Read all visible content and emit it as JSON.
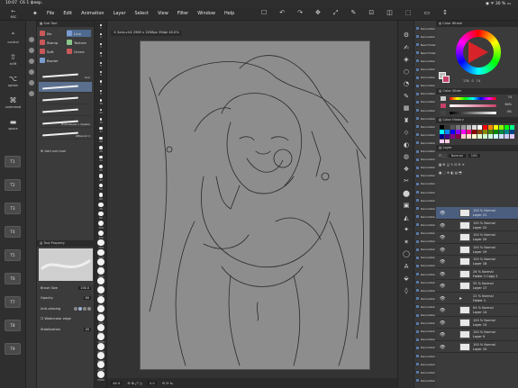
{
  "statusbar": {
    "time": "10:07",
    "date": "Cб 1 февр.",
    "right": "◉ ᯤ 30 % ▭"
  },
  "menubar": {
    "esc_label": "esc",
    "menus": [
      "File",
      "Edit",
      "Animation",
      "Layer",
      "Select",
      "View",
      "Filter",
      "Window",
      "Help"
    ],
    "tool_icons": [
      "☐",
      "↶",
      "↷",
      "✥",
      "⤢",
      "✎",
      "⊡",
      "◫",
      "⬚",
      "▭",
      "↕"
    ]
  },
  "leftbar": {
    "buttons": [
      {
        "icon": "⌃",
        "label": "control"
      },
      {
        "icon": "⇧",
        "label": "shift"
      },
      {
        "icon": "⌥",
        "label": "option"
      },
      {
        "icon": "⌘",
        "label": "command"
      },
      {
        "icon": "▬",
        "label": "space"
      }
    ],
    "numbered": [
      "T1",
      "T2",
      "T3",
      "T4",
      "T5",
      "T6",
      "T7",
      "T8",
      "T9"
    ]
  },
  "subtool": {
    "header": "▦ Sub Tool",
    "items": [
      {
        "label": "Mx",
        "color": "r"
      },
      {
        "label": "Line",
        "color": "b"
      },
      {
        "label": "Stamp",
        "color": "r"
      },
      {
        "label": "Texture",
        "color": "g"
      },
      {
        "label": "Soft",
        "color": "r"
      },
      {
        "label": "Grime",
        "color": "r"
      },
      {
        "label": "Border",
        "color": "b"
      }
    ],
    "brushes": [
      "Line",
      "",
      "",
      "",
      "Пояснение к правке",
      "GEpencil 2"
    ],
    "add_label": "Add sub tool"
  },
  "tool_property": {
    "header": "▤ Tool Property",
    "brush_size_label": "Brush Size",
    "brush_size_value": "100.0",
    "opacity_label": "Opacity",
    "opacity_value": "60",
    "anti_alias_label": "Anti-aliasing",
    "watercolor_label": "☐ Watercolor edge",
    "stabilization_label": "Stabilization",
    "stabilization_value": "45"
  },
  "brush_sizes": [
    "1",
    "2",
    "3",
    "4",
    "5",
    "6",
    "7",
    "8",
    "10",
    "12",
    "15",
    "17",
    "20",
    "25",
    "30",
    "35",
    "40",
    "50",
    "60",
    "70",
    "80",
    "100",
    "120",
    "150",
    "170",
    "200",
    "250",
    "300",
    "400",
    "500",
    "600",
    "700",
    "800",
    "1000",
    "1200",
    "1500",
    "1700",
    "2000"
  ],
  "canvas": {
    "doc_tab": "✕ Sans.clr4 2965 x 2058px 39dpi 40.0%",
    "status_zoom": "46.9",
    "status_angle": "0.0",
    "status_items": [
      "⊙",
      "⊕",
      "◐",
      "⟲",
      "⟳",
      "⤢"
    ]
  },
  "rightbar_icons": [
    "⚙",
    "✍",
    "◈",
    "⬡",
    "◔",
    "✎",
    "▦",
    "♜",
    "⬦",
    "◐",
    "◍",
    "❖",
    "✂",
    "⬤",
    "▣",
    "◭",
    "✦",
    "✶",
    "◯",
    "A",
    "⬙",
    "◊"
  ],
  "decoration_items": [
    "Decoration",
    "Decoration",
    "New Folder",
    "New Folder",
    "Decoration",
    "Decoration",
    "Decoration",
    "Decoration",
    "Decoration",
    "Decoration",
    "Decoration",
    "Decoration",
    "Decoration",
    "Decoration",
    "Decoration",
    "Decoration",
    "Decoration",
    "Decoration",
    "Decoration",
    "Decoration",
    "Decoration",
    "Decoration",
    "Decoration",
    "Decoration",
    "Decoration",
    "Decoration",
    "Decoration",
    "Decoration",
    "Decoration",
    "Decoration",
    "Decoration",
    "Decoration",
    "Decoration",
    "Decoration",
    "Decoration",
    "Decoration",
    "Decoration",
    "Decoration",
    "Decoration",
    "Decoration",
    "Decoration",
    "Decoration",
    "Decoration",
    "Decoration"
  ],
  "color_wheel": {
    "header": "◍ Color Wheel",
    "h": "178",
    "s": "0",
    "v": "74"
  },
  "color_slider": {
    "header": "▤ Color Slider",
    "rows": [
      {
        "value": "74",
        "color": "#cccccc"
      },
      {
        "value": "64%",
        "color": "#c8406a"
      },
      {
        "value": "0%",
        "color": "#444444"
      }
    ]
  },
  "color_history": {
    "header": "▥ Color History"
  },
  "palette_colors": [
    "#000000",
    "#333333",
    "#555555",
    "#777777",
    "#999999",
    "#bbbbbb",
    "#dddddd",
    "#ffffff",
    "#ff0000",
    "#ff8800",
    "#ffff00",
    "#88ff00",
    "#00ff00",
    "#00ff88",
    "#00ffff",
    "#0088ff",
    "#0000ff",
    "#8800ff",
    "#ff00ff",
    "#ff0088",
    "#880000",
    "#884400",
    "#888800",
    "#448800",
    "#008800",
    "#008844",
    "#008888",
    "#004488",
    "#000088",
    "#440088",
    "#880088",
    "#880044",
    "#ffcccc",
    "#ffe0cc",
    "#ffffcc",
    "#e0ffcc",
    "#ccffcc",
    "#ccffe0",
    "#ccffff",
    "#cce0ff",
    "#ccccff",
    "#e0ccff",
    "#ffccff",
    "#ffcce0"
  ],
  "layer": {
    "header": "▤ Layer",
    "mode": "Normal",
    "opacity": "100",
    "rows": [
      {
        "mode": "100 % Normal",
        "name": "Layer 21",
        "active": true,
        "folder": false
      },
      {
        "mode": "100 % Normal",
        "name": "Layer 22",
        "active": false,
        "folder": false
      },
      {
        "mode": "100 % Normal",
        "name": "Layer 20",
        "active": false,
        "folder": false
      },
      {
        "mode": "100 % Normal",
        "name": "Layer 19",
        "active": false,
        "folder": false
      },
      {
        "mode": "100 % Normal",
        "name": "Layer 18",
        "active": false,
        "folder": false
      },
      {
        "mode": "26 % Normal",
        "name": "Folder 1 Copy 2",
        "active": false,
        "folder": false
      },
      {
        "mode": "55 % Normal",
        "name": "Layer 17",
        "active": false,
        "folder": false
      },
      {
        "mode": "22 % Normal",
        "name": "Folder 1",
        "active": false,
        "folder": true
      },
      {
        "mode": "64 % Normal",
        "name": "Layer 14",
        "active": false,
        "folder": false
      },
      {
        "mode": "100 % Normal",
        "name": "Layer 13",
        "active": false,
        "folder": false
      },
      {
        "mode": "100 % Normal",
        "name": "Layer 9",
        "active": false,
        "folder": false
      },
      {
        "mode": "100 % Normal",
        "name": "Layer 10",
        "active": false,
        "folder": false
      }
    ]
  }
}
